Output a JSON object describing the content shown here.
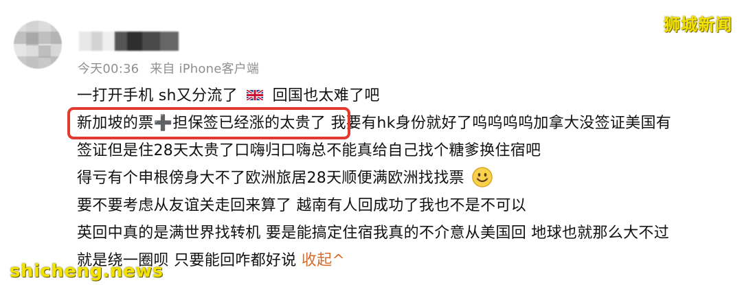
{
  "post": {
    "meta": {
      "time": "今天00:36",
      "source": "来自 iPhone客户端"
    },
    "lines": {
      "line1_before_flag": "一打开手机 sh又分流了",
      "line1_after_flag": "回国也太难了吧",
      "line2": "新加坡的票➕担保签已经涨的太贵了 我要有hk身份就好了呜呜呜呜加拿大没签证美国有",
      "line3": "签证但是住28天太贵了口嗨归口嗨总不能真给自己找个糖爹换住宿吧",
      "line4": "得亏有个申根傍身大不了欧洲旅居28天顺便满欧洲找找票",
      "line5": "要不要考虑从友谊关走回来算了 越南有人回成功了我也不是不可以",
      "line6": "英回中真的是满世界找转机 要是能搞定住宿我真的不介意从美国回 地球也就那么大不过",
      "line7": "就是绕一圈呗 只要能回咋都好说"
    },
    "collapse_label": "收起^",
    "icons": {
      "flag": "uk-flag-icon",
      "emoji": "smile-emoji-icon"
    }
  },
  "watermarks": {
    "top_right": "狮城新闻",
    "bottom_left": "shicheng.news"
  },
  "colors": {
    "highlight": "#e23a2f",
    "collapse": "#d86b2a",
    "watermark": "#f2e200"
  }
}
